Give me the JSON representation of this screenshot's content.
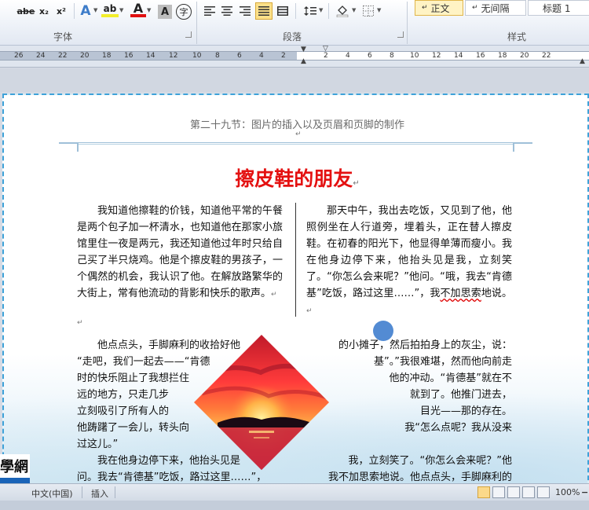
{
  "ribbon": {
    "groups": {
      "font": "字体",
      "paragraph": "段落",
      "styles": "样式"
    },
    "font_buttons": {
      "strike": "abe",
      "sub": "x₂",
      "sup": "x²",
      "text_effect": "A",
      "highlight": "ab",
      "font_color": "A",
      "char_shade": "A",
      "enclosed": "字"
    },
    "styles_gallery": [
      "正文",
      "无间隔",
      "标题 1"
    ],
    "style_prefix": "↵"
  },
  "ruler": {
    "ticks": [
      "26",
      "24",
      "22",
      "20",
      "18",
      "16",
      "14",
      "12",
      "10",
      "8",
      "6",
      "4",
      "2",
      "2",
      "4",
      "6",
      "8",
      "10",
      "12",
      "14",
      "16",
      "18",
      "20",
      "22"
    ]
  },
  "page": {
    "header": "第二十九节：图片的插入以及页眉和页脚的制作",
    "title": "擦皮鞋的朋友",
    "para_mark": "↵",
    "left_column": "我知道他擦鞋的价钱，知道他平常的午餐是两个包子加一杯清水，也知道他在那家小旅馆里住一夜是两元，我还知道他过年时只给自己买了半只烧鸡。他是个擦皮鞋的男孩子，一个偶然的机会，我认识了他。在解放路繁华的大街上，常有他流动的背影和快乐的歌声。",
    "right_column_before": "那天中午，我出去吃饭，又见到了他，他照例坐在人行道旁，埋着头，正在替人擦皮鞋。在初春的阳光下，他显得单薄而瘦小。我在他身边停下来，他抬头见是我，立刻笑了。“你怎么会来呢？”他问。“哦，我去“肯德基”吃饭，路过这里……”，我",
    "right_column_wavy": "不加思索",
    "right_column_after": "地说。",
    "wrap_left": [
      "他点点头，手脚麻利的收拾好他",
      "“走吧，我们一起去——“肯德",
      "时的快乐阻止了我想拦住",
      "远的地方，只走几步",
      "立刻吸引了所有人的",
      "他踌躇了一会儿，转头向",
      "过这儿。”",
      "我在他身边停下来，他抬头见是",
      "问。我去“肯德基”吃饭，路过这里……”，"
    ],
    "wrap_right": [
      "的小摊子，然后拍拍身上的灰尘，说：",
      "基”。”我很难堪，然而他向前走",
      "他的冲动。“肯德基”就在不",
      "就到了。他推门进去，",
      "目光——那的存在。",
      "我“怎么点呢？我从没来",
      "",
      "我，立刻笑了。“你怎么会来呢？”他",
      "我不加思索地说。他点点头，手脚麻利的"
    ]
  },
  "status": {
    "language": "中文(中国)",
    "mode": "插入",
    "zoom": "100%",
    "zoom_minus": "−"
  },
  "watermark": {
    "top": "學網",
    "bottom": ".com"
  }
}
